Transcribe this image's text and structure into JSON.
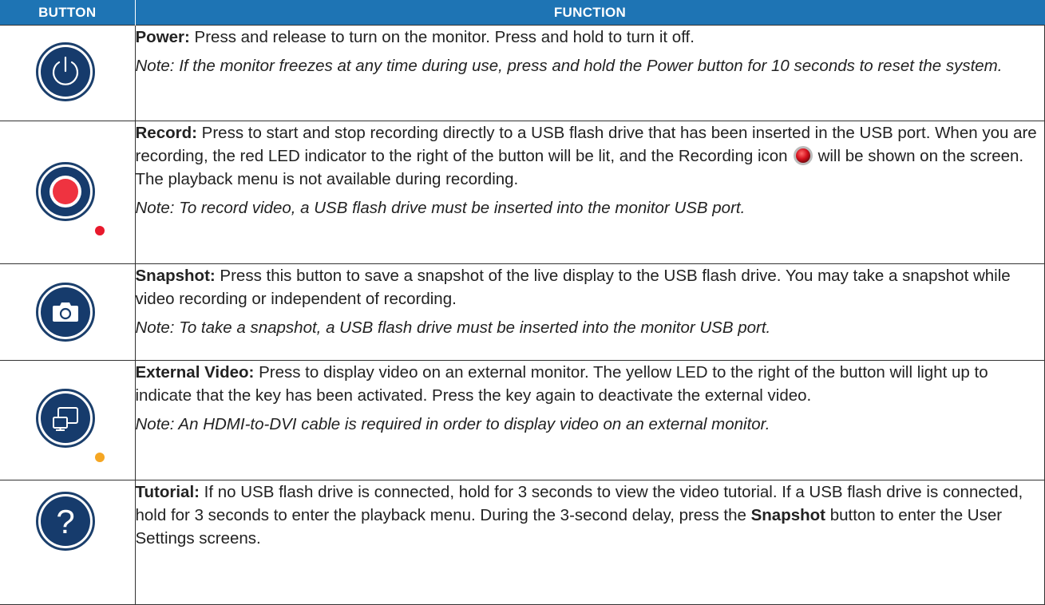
{
  "header": {
    "button_col": "BUTTON",
    "function_col": "FUNCTION"
  },
  "rows": [
    {
      "icon": "power-icon",
      "title": "Power:",
      "text": " Press and release to turn on the monitor. Press and hold to turn it off.",
      "note": "Note: If the monitor freezes at any time during use, press and hold the Power button for 10 seconds to reset the system."
    },
    {
      "icon": "record-icon",
      "title": "Record:",
      "text_a": " Press to start and stop recording directly to a USB flash drive that has been inserted in the USB port. When you are recording, the red LED indicator to the right of the button will be lit, and the Recording icon",
      "text_b": "will be shown on the screen. The playback menu is not available during recording.",
      "note": "Note: To record video, a USB flash drive must be inserted into the monitor USB port.",
      "led_color": "#e8192c"
    },
    {
      "icon": "camera-icon",
      "title": "Snapshot:",
      "text": " Press this button to save a snapshot of the live display to the USB flash drive. You may take a snapshot while video recording or independent of recording.",
      "note": "Note: To take a snapshot, a USB flash drive must be inserted into the monitor USB port."
    },
    {
      "icon": "external-display-icon",
      "title": "External Video:",
      "text": " Press to display video on an external monitor. The yellow LED to the right of the button will light up to indicate that the key has been activated. Press the key again to deactivate the external video.",
      "note": "Note: An HDMI-to-DVI cable is required in order to display video on an external monitor.",
      "led_color": "#f5a623"
    },
    {
      "icon": "question-mark-icon",
      "title": "Tutorial:",
      "text_a": " If no USB flash drive is connected, hold for 3 seconds to view the video tutorial. If a USB flash drive is connected, hold for 3 seconds to enter the playback menu. During the 3-second delay, press the ",
      "bold_word": "Snapshot",
      "text_b": " button to enter the User Settings screens."
    }
  ],
  "colors": {
    "header_bg": "#1e74b4",
    "icon_navy": "#163b6c",
    "record_red": "#e8192c",
    "led_yellow": "#f5a623"
  }
}
